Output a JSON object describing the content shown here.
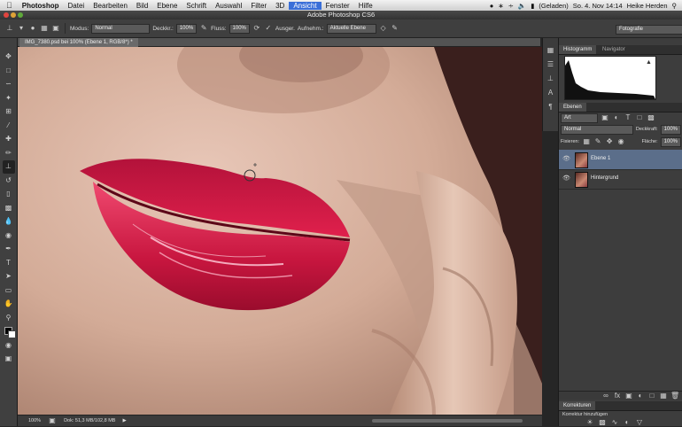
{
  "menubar": {
    "items": [
      "Photoshop",
      "Datei",
      "Bearbeiten",
      "Bild",
      "Ebene",
      "Schrift",
      "Auswahl",
      "Filter",
      "3D",
      "Ansicht",
      "Fenster",
      "Hilfe"
    ],
    "active_item": "Ansicht",
    "battery": "(Geladen)",
    "clock": "So. 4. Nov 14:14",
    "user": "Heike Herden"
  },
  "window": {
    "title": "Adobe Photoshop CS6"
  },
  "options": {
    "mode_label": "Modus:",
    "mode_value": "Normal",
    "opacity_label": "Deckkr.:",
    "opacity_value": "100%",
    "flow_label": "Fluss:",
    "flow_value": "100%",
    "aligned_label": "Ausger.",
    "sample_label": "Aufnehm.:",
    "sample_value": "Aktuelle Ebene",
    "workspace": "Fotografie"
  },
  "document": {
    "tab_label": "IMG_7380.psd bei 100% (Ebene 1, RGB/8*) *",
    "zoom": "100%",
    "doc_info": "Dok: 51,3 MB/102,8 MB"
  },
  "panels": {
    "histogram_tabs": [
      "Histogramm",
      "Navigator"
    ],
    "layers_tab": "Ebenen",
    "filter_kind": "Art",
    "blend_mode": "Normal",
    "opacity_label": "Deckkraft:",
    "opacity_value": "100%",
    "lock_label": "Fixieren:",
    "fill_label": "Fläche:",
    "fill_value": "100%",
    "layers": [
      "Ebene 1",
      "Hintergrund"
    ],
    "corrections_tab": "Korrekturen",
    "corrections_add": "Korrektur hinzufügen"
  },
  "colors": {
    "menu_highlight": "#3a6fd8",
    "selected_layer": "#5b6e8a",
    "lips": "#c8163f"
  }
}
